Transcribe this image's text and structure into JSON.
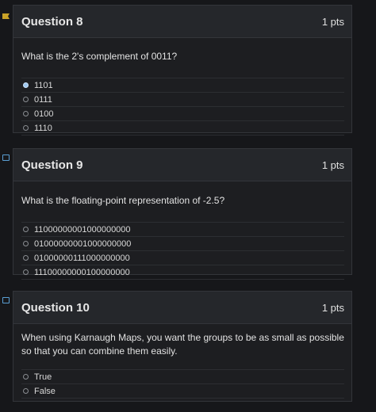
{
  "questions": [
    {
      "title": "Question 8",
      "points": "1 pts",
      "text": "What is the 2's complement of 0011?",
      "flagged": true,
      "answers": [
        "1101",
        "0111",
        "0100",
        "1110"
      ],
      "selected_index": 0
    },
    {
      "title": "Question 9",
      "points": "1 pts",
      "text": "What is the floating-point representation of -2.5?",
      "flagged": false,
      "answers": [
        "11000000001000000000",
        "01000000001000000000",
        "01000000111000000000",
        "11100000000100000000"
      ],
      "selected_index": null
    },
    {
      "title": "Question 10",
      "points": "1 pts",
      "text": "When using Karnaugh Maps, you want the groups to be as small as possible so that you can combine them easily.",
      "flagged": false,
      "answers": [
        "True",
        "False"
      ],
      "selected_index": null
    }
  ],
  "colors": {
    "background": "#16171a",
    "card": "#1d1e21",
    "card_header": "#25272b",
    "flag_filled": "#c9a227",
    "flag_outline": "#5a9fd4",
    "selected_radio": "#9fc8f0"
  }
}
